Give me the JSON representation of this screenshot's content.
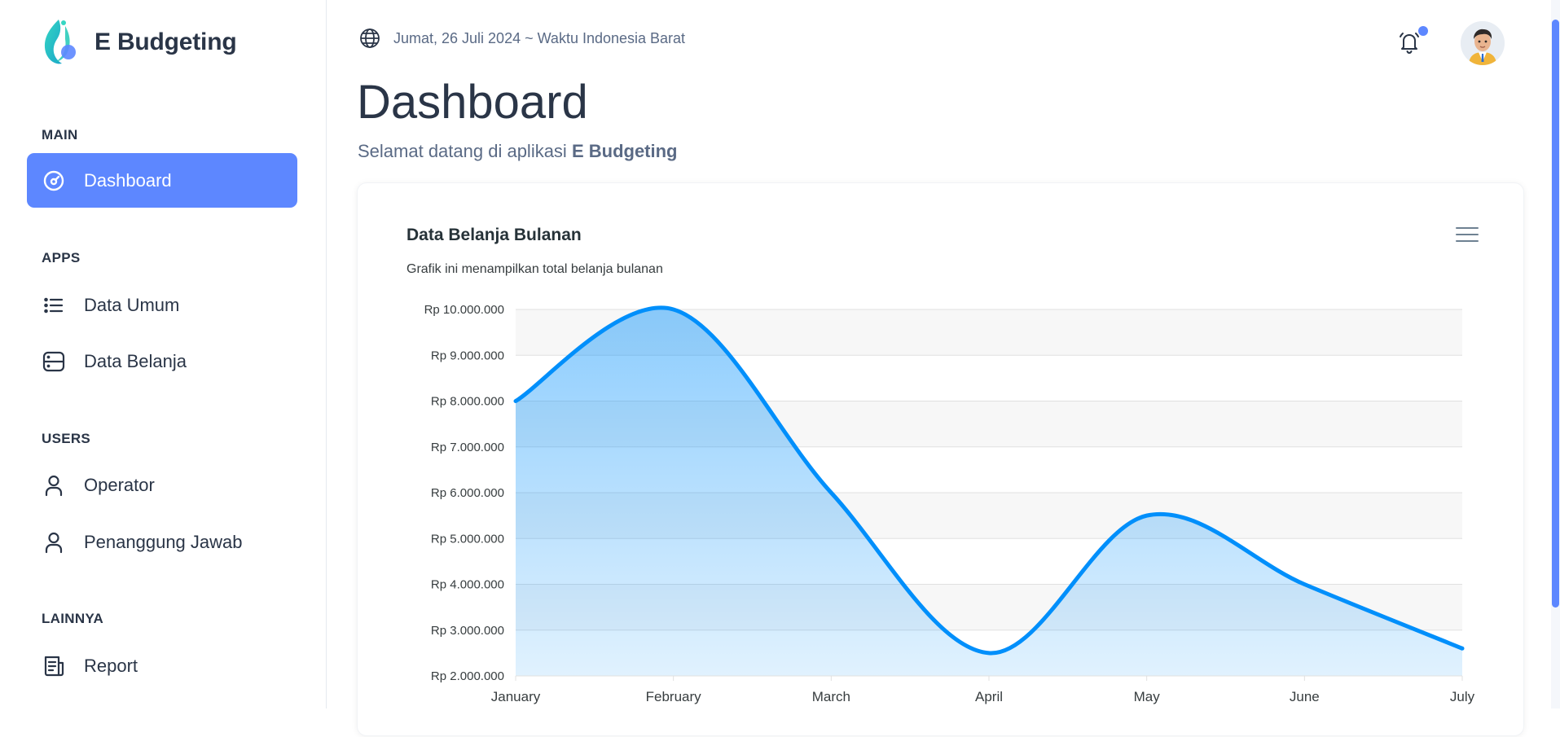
{
  "brand": {
    "name": "E Budgeting",
    "logo_icon": "ebudgeting-logo"
  },
  "sidebar": {
    "sections": [
      {
        "title": "MAIN"
      },
      {
        "title": "APPS"
      },
      {
        "title": "USERS"
      },
      {
        "title": "LAINNYA"
      }
    ],
    "items": [
      {
        "label": "Dashboard",
        "icon": "gauge-icon",
        "active": true
      },
      {
        "label": "Data Umum",
        "icon": "list-icon"
      },
      {
        "label": "Data Belanja",
        "icon": "server-icon"
      },
      {
        "label": "Operator",
        "icon": "user-icon"
      },
      {
        "label": "Penanggung Jawab",
        "icon": "user-icon"
      },
      {
        "label": "Report",
        "icon": "report-icon"
      }
    ]
  },
  "header": {
    "date_text": "Jumat, 26 Juli 2024 ~ Waktu Indonesia Barat",
    "notification_icon": "bell-icon"
  },
  "page": {
    "title": "Dashboard",
    "welcome_prefix": "Selamat datang di aplikasi",
    "welcome_app": "E Budgeting"
  },
  "colors": {
    "accent": "#5d87ff",
    "series": "#008ffb",
    "text": "#2a3547"
  },
  "chart_data": {
    "type": "area",
    "title": "Data Belanja Bulanan",
    "subtitle": "Grafik ini menampilkan total belanja bulanan",
    "categories": [
      "January",
      "February",
      "March",
      "April",
      "May",
      "June",
      "July"
    ],
    "series": [
      {
        "values": [
          8000000,
          10000000,
          6000000,
          2500000,
          5500000,
          4000000,
          2600000
        ]
      }
    ],
    "yticks": [
      "Rp 10.000.000",
      "Rp 9.000.000",
      "Rp 8.000.000",
      "Rp 7.000.000",
      "Rp 6.000.000",
      "Rp 5.000.000",
      "Rp 4.000.000",
      "Rp 3.000.000",
      "Rp 2.000.000"
    ],
    "ylim": [
      2000000,
      10000000
    ],
    "grid": true,
    "curve": "smooth"
  }
}
